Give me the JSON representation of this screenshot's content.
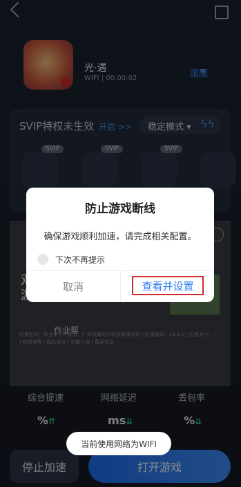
{
  "game": {
    "name": "光·遇",
    "network": "WIFI",
    "separator": "|",
    "timer": "00:00:02",
    "region": "国服"
  },
  "svip": {
    "title": "SVIP特权未生效",
    "open_link": "开启 >>",
    "mode": "稳定模式 ▾",
    "bolt": "ϟϟ",
    "tag": "SVIP"
  },
  "ad": {
    "text": "双 游",
    "source": "作业帮",
    "fine_print": "应用名称：作业帮 | 开发者：广州视睿电子科技有限公司 | 应用版本：14.4.0 | 应用大小：… | 权限详情 | 隐私协议 | 功能介绍 | 备案信息"
  },
  "stats": {
    "labels": [
      "综合提速",
      "网络延迟",
      "丢包率"
    ],
    "values": [
      "%",
      "ms",
      "%"
    ]
  },
  "buttons": {
    "stop": "停止加速",
    "open_game": "打开游戏"
  },
  "dialog": {
    "title": "防止游戏断线",
    "message": "确保游戏顺利加速，请完成相关配置。",
    "checkbox_label": "下次不再提示",
    "cancel": "取消",
    "confirm": "查看并设置"
  },
  "toast": "当前使用网络为WIFI",
  "colors": {
    "accent": "#3f8bf5",
    "highlight_box": "#d12b2b",
    "primary_button": "#1e6ef0"
  }
}
